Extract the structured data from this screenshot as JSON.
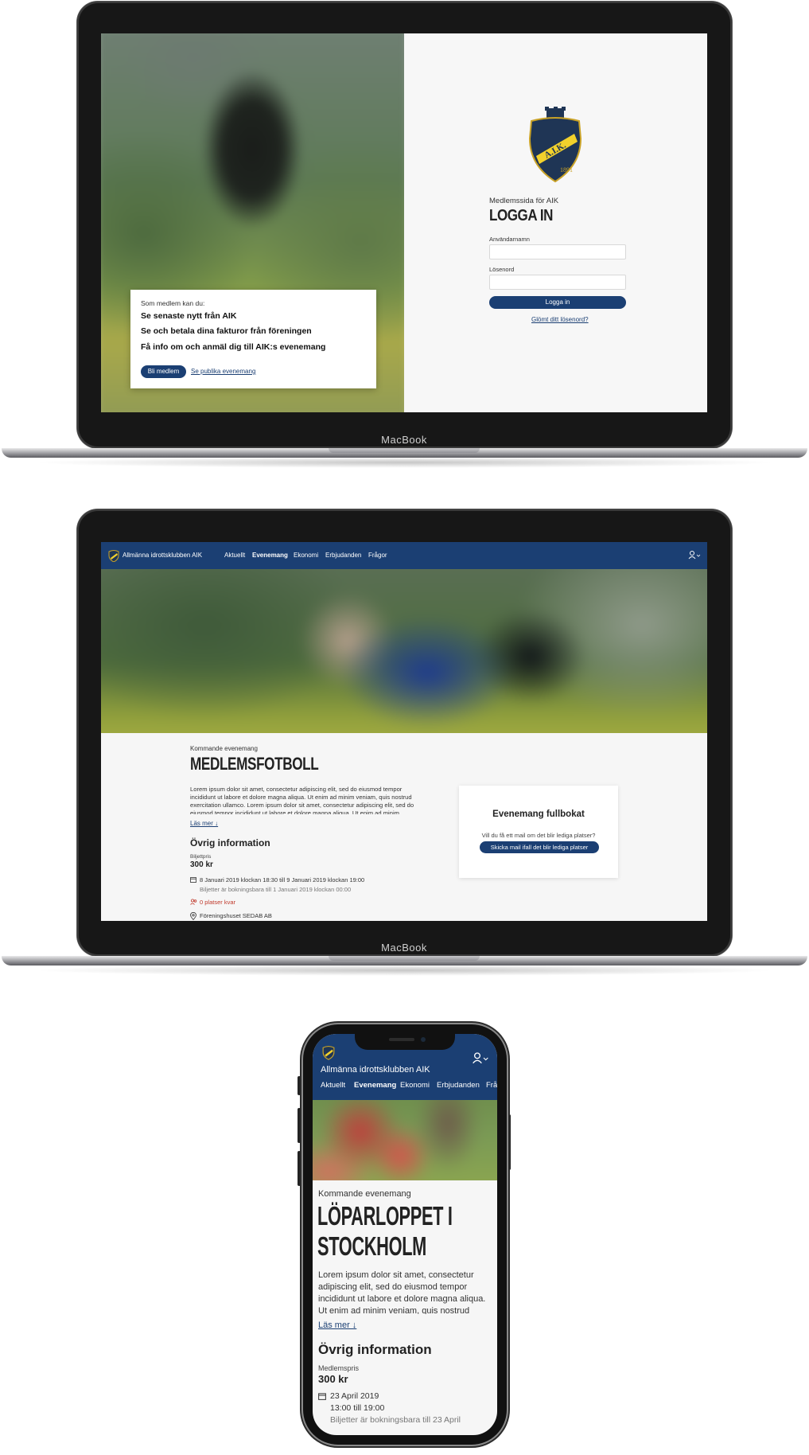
{
  "laptop_label": "MacBook",
  "colors": {
    "brand_blue": "#1b3f73",
    "warning_red": "#c0392b",
    "crest_yellow": "#f2d12c"
  },
  "login_screen": {
    "members_card": {
      "intro": "Som medlem kan du:",
      "benefits": [
        "Se senaste nytt från AIK",
        "Se och betala dina fakturor från föreningen",
        "Få info om och anmäl dig till AIK:s evenemang"
      ],
      "become_member_button": "Bli medlem",
      "public_events_link": "Se publika evenemang"
    },
    "form": {
      "subtitle": "Medlemssida för AIK",
      "title": "LOGGA IN",
      "username_label": "Användarnamn",
      "password_label": "Lösenord",
      "login_button": "Logga in",
      "forgot_link": "Glömt ditt lösenord?"
    },
    "crest": {
      "icon": "aik-crest-icon",
      "letters": "A.I.K.",
      "year": "1891"
    }
  },
  "event_desktop": {
    "club_name": "Allmänna idrottsklubben AIK",
    "nav": [
      "Aktuellt",
      "Evenemang",
      "Ekonomi",
      "Erbjudanden",
      "Frågor"
    ],
    "active_nav": "Evenemang",
    "user_icon": "user-icon",
    "kicker": "Kommande evenemang",
    "title": "MEDLEMSFOTBOLL",
    "lorem_lines": [
      "Lorem ipsum dolor sit amet, consectetur adipiscing elit, sed do eiusmod tempor",
      "incididunt ut labore et dolore magna aliqua. Ut enim ad minim veniam, quis nostrud",
      "exercitation ullamco. Lorem ipsum dolor sit amet, consectetur adipiscing elit, sed do",
      "eiusmod tempor incididunt ut labore et dolore magna aliqua. Ut enim ad minim"
    ],
    "read_more": "Läs mer ↓",
    "other_info_heading": "Övrig information",
    "price_label": "Biljettpris",
    "price": "300 kr",
    "date_text": "8 Januari 2019 klockan 18:30 till 9 Januari 2019 klockan 19:00",
    "booking_text": "Biljetter är bokningsbara till 1 Januari 2019 klockan 00:00",
    "spots_text": "0 platser kvar",
    "location_text": "Föreningshuset SEDAB AB",
    "fully_booked_card": {
      "title": "Evenemang fullbokat",
      "question": "Vill du få ett mail om det blir lediga platser?",
      "button": "Skicka mail ifall det blir lediga platser"
    }
  },
  "event_mobile": {
    "club_name": "Allmänna idrottsklubben AIK",
    "nav": [
      "Aktuellt",
      "Evenemang",
      "Ekonomi",
      "Erbjudanden",
      "Frå"
    ],
    "active_nav": "Evenemang",
    "kicker": "Kommande evenemang",
    "title_line1": "LÖPARLOPPET I",
    "title_line2": "STOCKHOLM",
    "lorem_lines": [
      "Lorem ipsum dolor sit amet, consectetur",
      "adipiscing elit, sed do eiusmod tempor",
      "incididunt ut labore et dolore magna aliqua.",
      "Ut enim ad minim veniam, quis nostrud"
    ],
    "read_more": "Läs mer ↓",
    "other_info_heading": "Övrig information",
    "price_label": "Medlemspris",
    "price": "300 kr",
    "date_line1": "23 April 2019",
    "date_line2": "13:00 till 19:00",
    "booking_text": "Biljetter är bokningsbara till 23 April"
  }
}
